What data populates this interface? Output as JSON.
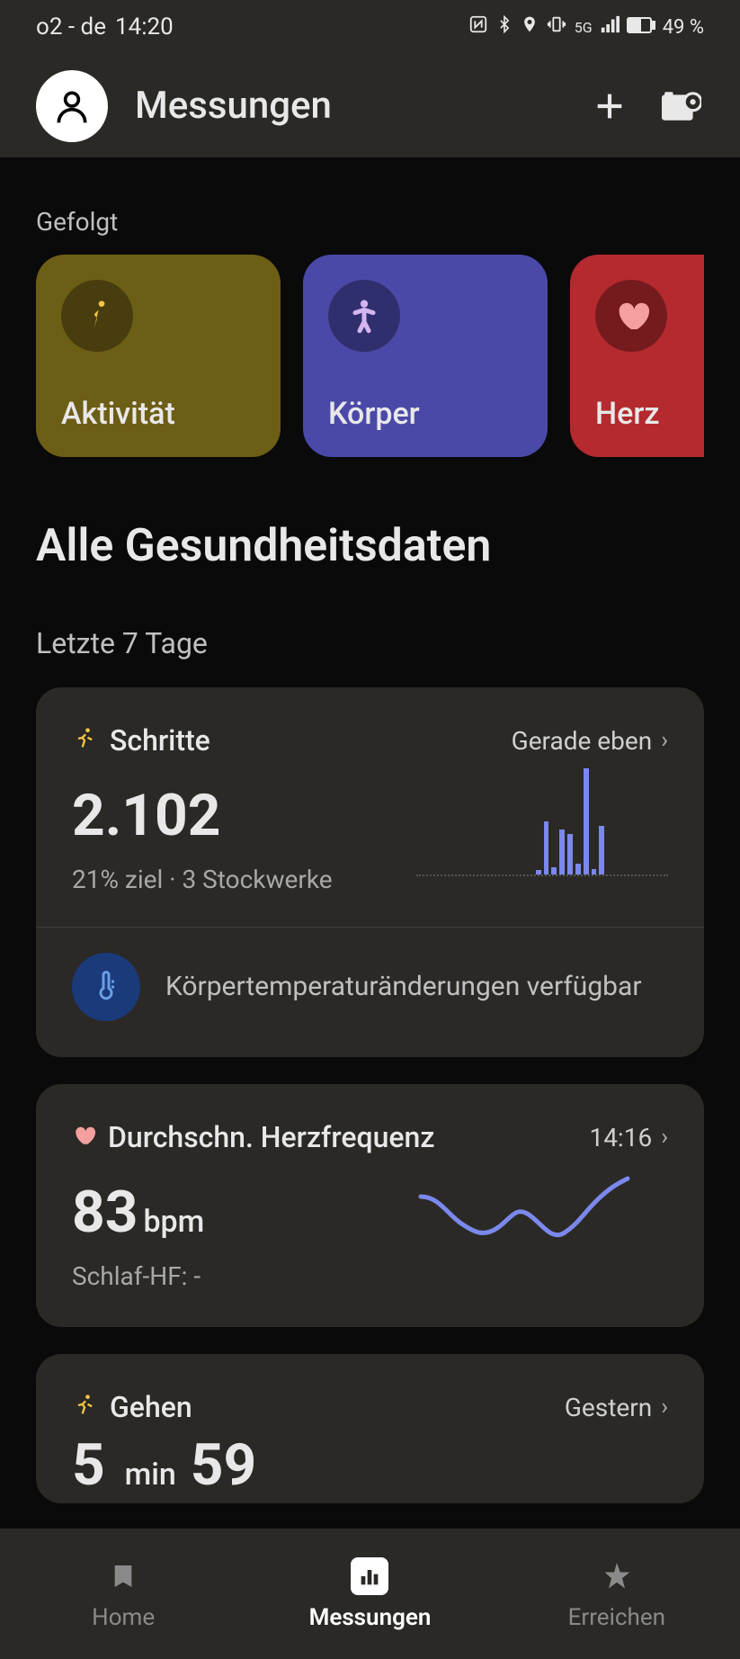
{
  "status": {
    "carrier": "o2 - de",
    "time": "14:20",
    "battery": "49 %"
  },
  "header": {
    "title": "Messungen"
  },
  "followed": {
    "label": "Gefolgt",
    "tiles": [
      {
        "label": "Aktivität"
      },
      {
        "label": "Körper"
      },
      {
        "label": "Herz"
      }
    ]
  },
  "allData": {
    "title": "Alle Gesundheitsdaten",
    "range": "Letzte 7 Tage"
  },
  "steps": {
    "title": "Schritte",
    "time": "Gerade eben",
    "value": "2.102",
    "sub": "21% ziel  · 3 Stockwerke",
    "notice": "Körpertemperaturänderungen verfügbar"
  },
  "heart": {
    "title": "Durchschn. Herzfrequenz",
    "time": "14:16",
    "value": "83",
    "unit": "bpm",
    "sub": "Schlaf-HF: -"
  },
  "walk": {
    "title": "Gehen",
    "time": "Gestern",
    "value_min": "5",
    "value_sec": "59",
    "unit_min": "min"
  },
  "nav": {
    "home": "Home",
    "measure": "Messungen",
    "achieve": "Erreichen"
  },
  "chart_data": [
    {
      "type": "bar",
      "title": "Schritte (letzte 24h, sparkline)",
      "categories": [],
      "values": [
        0,
        0,
        0,
        0,
        0,
        0,
        0,
        0,
        0,
        0,
        0,
        0,
        0,
        0,
        0,
        0,
        0,
        5,
        60,
        8,
        50,
        45,
        12,
        120,
        6,
        55,
        0,
        0,
        0,
        0,
        0,
        0,
        0,
        0,
        0
      ],
      "ylim": [
        0,
        120
      ]
    },
    {
      "type": "line",
      "title": "Herzfrequenz (sparkline)",
      "x": [
        0,
        1,
        2,
        3,
        4,
        5,
        6,
        7,
        8,
        9
      ],
      "values": [
        80,
        72,
        68,
        74,
        70,
        65,
        78,
        76,
        85,
        90
      ],
      "ylim": [
        60,
        95
      ]
    }
  ]
}
